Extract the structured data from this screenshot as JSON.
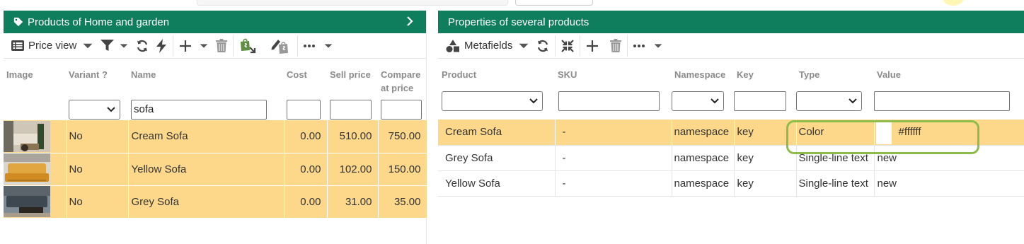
{
  "left_panel": {
    "title": "Products of Home and garden",
    "toolbar": {
      "view_label": "Price view"
    },
    "columns": [
      "Image",
      "Variant ?",
      "Name",
      "Cost",
      "Sell price",
      "Compare at price"
    ],
    "filters": {
      "name_value": "sofa",
      "variant_value": ""
    },
    "rows": [
      {
        "variant": "No",
        "name": "Cream Sofa",
        "cost": "0.00",
        "sell_price": "510.00",
        "compare_price": "750.00"
      },
      {
        "variant": "No",
        "name": "Yellow Sofa",
        "cost": "0.00",
        "sell_price": "102.00",
        "compare_price": "150.00"
      },
      {
        "variant": "No",
        "name": "Grey Sofa",
        "cost": "0.00",
        "sell_price": "31.00",
        "compare_price": "35.00"
      }
    ]
  },
  "right_panel": {
    "title": "Properties of several products",
    "toolbar": {
      "view_label": "Metafields"
    },
    "columns": [
      "Product",
      "SKU",
      "Namespace",
      "Key",
      "Type",
      "Value"
    ],
    "rows": [
      {
        "product": "Cream Sofa",
        "sku": "-",
        "namespace": "namespace",
        "key": "key",
        "type": "Color",
        "value": "#ffffff"
      },
      {
        "product": "Grey Sofa",
        "sku": "-",
        "namespace": "namespace",
        "key": "key",
        "type": "Single-line text",
        "value": "new"
      },
      {
        "product": "Yellow Sofa",
        "sku": "-",
        "namespace": "namespace",
        "key": "key",
        "type": "Single-line text",
        "value": "new"
      }
    ]
  },
  "colors": {
    "header_green": "#0f7e5d",
    "row_highlight": "#fdd88a",
    "focus_outline": "#8dbc4b"
  },
  "icons": [
    "tag-icon",
    "chevron-right-icon",
    "list-icon",
    "caret-down-icon",
    "filter-icon",
    "refresh-icon",
    "lightning-icon",
    "plus-icon",
    "trash-icon",
    "shopify-import-icon",
    "shopify-edit-icon",
    "more-icon",
    "shapes-icon",
    "collapse-icon"
  ]
}
